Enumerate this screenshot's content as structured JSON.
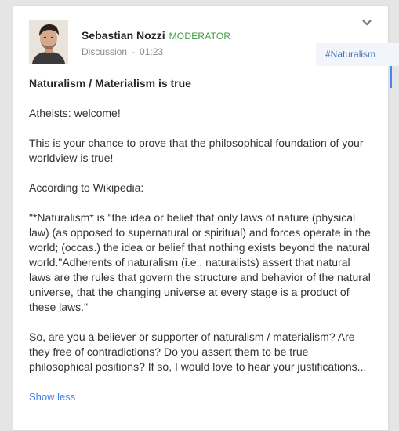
{
  "post": {
    "author": "Sebastian Nozzi",
    "role": "MODERATOR",
    "category": "Discussion",
    "separator": "-",
    "time": "01:23",
    "hashtag": "#Naturalism",
    "title": "Naturalism / Materialism is true",
    "paragraphs": [
      "Atheists: welcome!",
      "This is your chance to prove that the philosophical foundation of your worldview is true!",
      "According to Wikipedia:",
      "\"*Naturalism* is \"the idea or belief that only laws of nature (physical law) (as opposed to supernatural or spiritual) and forces operate in the world; (occas.) the idea or belief that nothing exists beyond the natural world.\"Adherents of naturalism (i.e., naturalists) assert that natural laws are the rules that govern the structure and behavior of the natural universe, that the changing universe at every stage is a product of these laws.\"",
      "So, are you a believer or supporter of naturalism / materialism? Are they free of contradictions? Do you assert them to be true philosophical positions? If so, I would love to hear your justifications..."
    ],
    "show_less": "Show less"
  },
  "icons": {
    "menu": "chevron-down-icon",
    "avatar": "profile-photo"
  },
  "colors": {
    "role": "#3d9d3d",
    "link": "#427fed",
    "hashtag": "#4271b8",
    "accent": "#4285f4"
  }
}
